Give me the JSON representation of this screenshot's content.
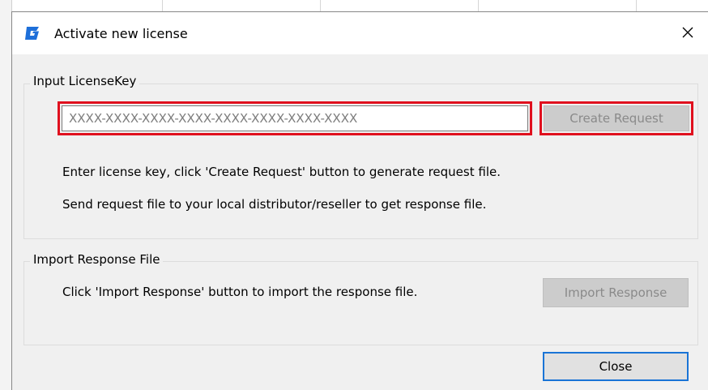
{
  "window": {
    "title": "Activate new license",
    "app_icon": "gstarcad-g-icon",
    "close_icon": "close-icon"
  },
  "input_group": {
    "label": "Input LicenseKey",
    "license_placeholder": "XXXX-XXXX-XXXX-XXXX-XXXX-XXXX-XXXX-XXXX",
    "create_request_label": "Create Request",
    "info_line_1": "Enter license key, click 'Create Request' button to generate request file.",
    "info_line_2": "Send request file to your local distributor/reseller to get response file."
  },
  "import_group": {
    "label": "Import Response File",
    "info_line": "Click 'Import Response' button to import the response file.",
    "import_response_label": "Import Response"
  },
  "footer": {
    "close_label": "Close"
  },
  "colors": {
    "highlight": "#e0101e",
    "focus_border": "#1a74d6",
    "app_icon_blue": "#1e6fd9",
    "dialog_bg": "#f0f0f0"
  }
}
